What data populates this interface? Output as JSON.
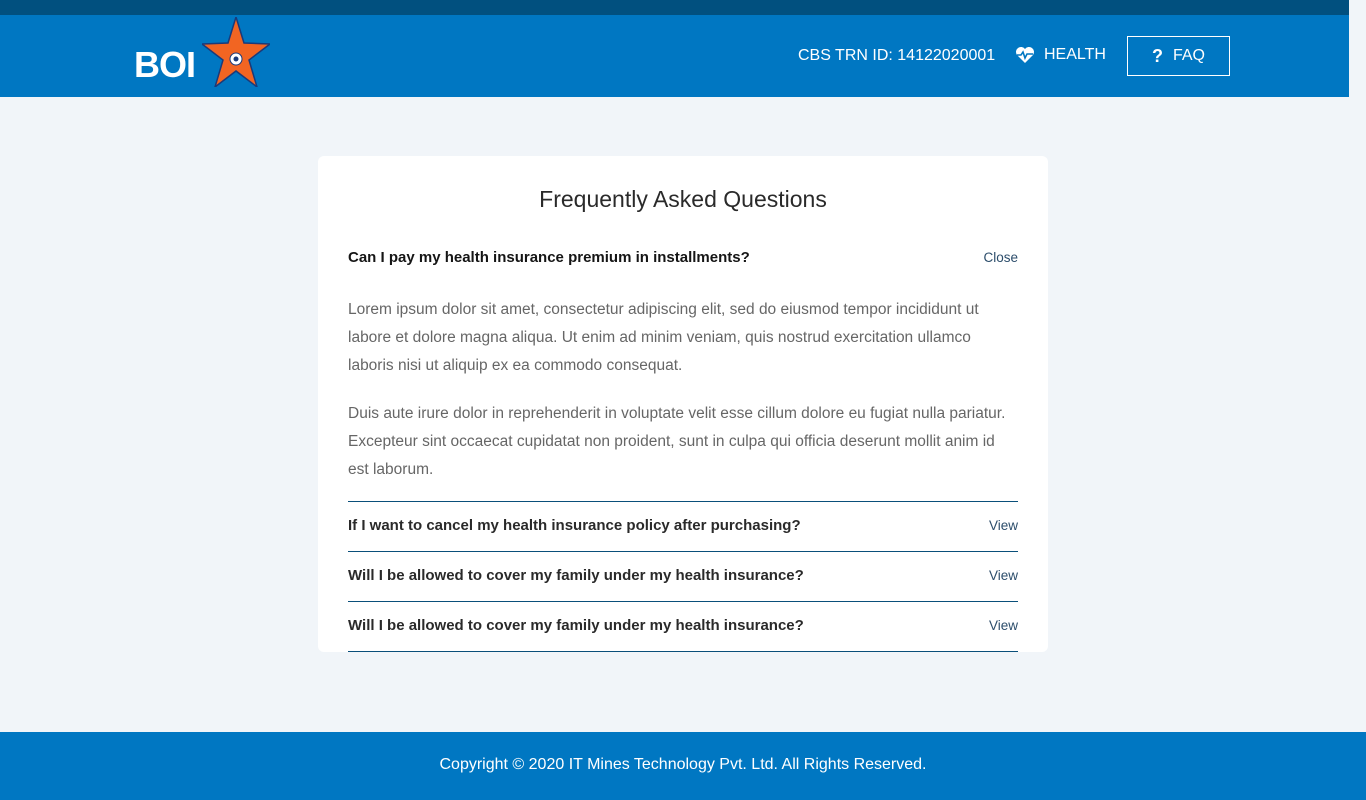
{
  "header": {
    "logo_text": "BOI",
    "trn_label": "CBS TRN ID: 14122020001",
    "health_label": "HEALTH",
    "health_icon": "heart-pulse-icon",
    "faq_label": "FAQ",
    "faq_icon": "question-mark-icon"
  },
  "faq": {
    "title": "Frequently Asked Questions",
    "open_item": {
      "question": "Can I pay my health insurance premium in installments?",
      "action": "Close",
      "answer_p1": "Lorem ipsum dolor sit amet, consectetur adipiscing elit, sed do eiusmod tempor incididunt ut labore et dolore magna aliqua. Ut enim ad minim veniam, quis nostrud exercitation ullamco laboris nisi ut aliquip ex ea commodo consequat.",
      "answer_p2": "Duis aute irure dolor in reprehenderit in voluptate velit esse cillum dolore eu fugiat nulla pariatur. Excepteur sint occaecat cupidatat non proident, sunt in culpa qui officia deserunt mollit anim id est laborum."
    },
    "items": [
      {
        "question": "If I want to cancel my health insurance policy after purchasing?",
        "action": "View"
      },
      {
        "question": "Will I be allowed to cover my family under my health insurance?",
        "action": "View"
      },
      {
        "question": "Will I be allowed to cover my family under my health insurance?",
        "action": "View"
      }
    ]
  },
  "footer": {
    "copyright": "Copyright © 2020 IT Mines Technology Pvt. Ltd. All Rights Reserved."
  },
  "colors": {
    "header_blue": "#0077c2",
    "top_strip": "#01507f",
    "star_orange": "#f26522",
    "page_bg": "#f1f5f9"
  }
}
